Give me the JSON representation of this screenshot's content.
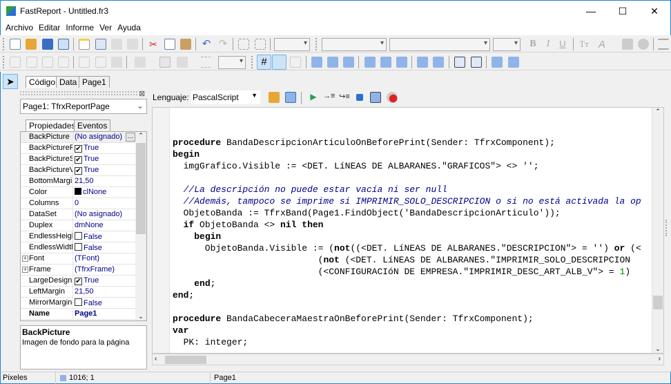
{
  "window": {
    "title": "FastReport - Untitled.fr3",
    "minimize": "—",
    "maximize": "☐",
    "close": "✕"
  },
  "menu": [
    "Archivo",
    "Editar",
    "Informe",
    "Ver",
    "Ayuda"
  ],
  "design_tabs": [
    "Código",
    "Data",
    "Page1"
  ],
  "object_selector": "Page1: TfrxReportPage",
  "inspector_tabs": [
    "Propiedades",
    "Eventos"
  ],
  "properties": [
    {
      "name": "BackPicture",
      "value": "(No asignado)",
      "ellipsis": true
    },
    {
      "name": "BackPicturePrintable",
      "value": "True",
      "check": true
    },
    {
      "name": "BackPictureStretched",
      "value": "True",
      "check": true
    },
    {
      "name": "BackPictureVisible",
      "value": "True",
      "check": true
    },
    {
      "name": "BottomMargin",
      "value": "21,50"
    },
    {
      "name": "Color",
      "value": "clNone",
      "swatch": "#000000"
    },
    {
      "name": "Columns",
      "value": "0"
    },
    {
      "name": "DataSet",
      "value": "(No asignado)"
    },
    {
      "name": "Duplex",
      "value": "dmNone"
    },
    {
      "name": "EndlessHeight",
      "value": "False",
      "check": false
    },
    {
      "name": "EndlessWidth",
      "value": "False",
      "check": false
    },
    {
      "name": "Font",
      "value": "(TFont)",
      "expand": true
    },
    {
      "name": "Frame",
      "value": "(TfrxFrame)",
      "expand": true
    },
    {
      "name": "LargeDesignHeight",
      "value": "True",
      "check": true
    },
    {
      "name": "LeftMargin",
      "value": "21,50"
    },
    {
      "name": "MirrorMargins",
      "value": "False",
      "check": false
    },
    {
      "name": "Name",
      "value": "Page1",
      "bold": true
    }
  ],
  "description": {
    "title": "BackPicture",
    "text": "Imagen de fondo para la página"
  },
  "editor_toolbar": {
    "language_label": "Lenguaje:",
    "language": "PascalScript"
  },
  "code_lines": [
    [],
    [],
    [
      [
        "kw",
        "procedure"
      ],
      [
        "t",
        " BandaDescripcionArticuloOnBeforePrint(Sender: TfrxComponent);"
      ]
    ],
    [
      [
        "kw",
        "begin"
      ]
    ],
    [
      [
        "t",
        "  imgGrafico.Visible := <DET. LíNEAS DE ALBARANES.\"GRAFICOS\"> <> "
      ],
      [
        "str",
        "''"
      ],
      [
        "t",
        ";"
      ]
    ],
    [],
    [
      [
        "cm",
        "  //La descripción no puede estar vacía ni ser null"
      ]
    ],
    [
      [
        "cm",
        "  //Además, tampoco se imprime si IMPRIMIR_SOLO_DESCRIPCION o si no está activada la op"
      ]
    ],
    [
      [
        "t",
        "  ObjetoBanda := TfrxBand(Page1.FindObject("
      ],
      [
        "str",
        "'BandaDescripcionArticulo'"
      ],
      [
        "t",
        "));"
      ]
    ],
    [
      [
        "t",
        "  "
      ],
      [
        "kw",
        "if"
      ],
      [
        "t",
        " ObjetoBanda <> "
      ],
      [
        "kw",
        "nil"
      ],
      [
        "t",
        " "
      ],
      [
        "kw",
        "then"
      ]
    ],
    [
      [
        "t",
        "    "
      ],
      [
        "kw",
        "begin"
      ]
    ],
    [
      [
        "t",
        "      ObjetoBanda.Visible := ("
      ],
      [
        "kw",
        "not"
      ],
      [
        "t",
        "((<DET. LíNEAS DE ALBARANES.\"DESCRIPCION\"> = "
      ],
      [
        "str",
        "''"
      ],
      [
        "t",
        ") "
      ],
      [
        "kw",
        "or"
      ],
      [
        "t",
        " (<"
      ]
    ],
    [
      [
        "t",
        "                           ("
      ],
      [
        "kw",
        "not"
      ],
      [
        "t",
        " (<DET. LíNEAS DE ALBARANES.\"IMPRIMIR_SOLO_DESCRIPCION"
      ]
    ],
    [
      [
        "t",
        "                           (<CONFIGURACIóN DE EMPRESA.\"IMPRIMIR_DESC_ART_ALB_V\"> = "
      ],
      [
        "num",
        "1"
      ],
      [
        "t",
        ")"
      ]
    ],
    [
      [
        "t",
        "    "
      ],
      [
        "kw",
        "end"
      ],
      [
        "t",
        ";"
      ]
    ],
    [
      [
        "kw",
        "end"
      ],
      [
        "t",
        ";"
      ]
    ],
    [],
    [
      [
        "kw",
        "procedure"
      ],
      [
        "t",
        " BandaCabeceraMaestraOnBeforePrint(Sender: TfrxComponent);"
      ]
    ],
    [
      [
        "kw",
        "var"
      ]
    ],
    [
      [
        "t",
        "  PK: integer;"
      ]
    ]
  ],
  "status": {
    "units": "Pixeles",
    "position": "1016; 1",
    "page": "Page1"
  }
}
